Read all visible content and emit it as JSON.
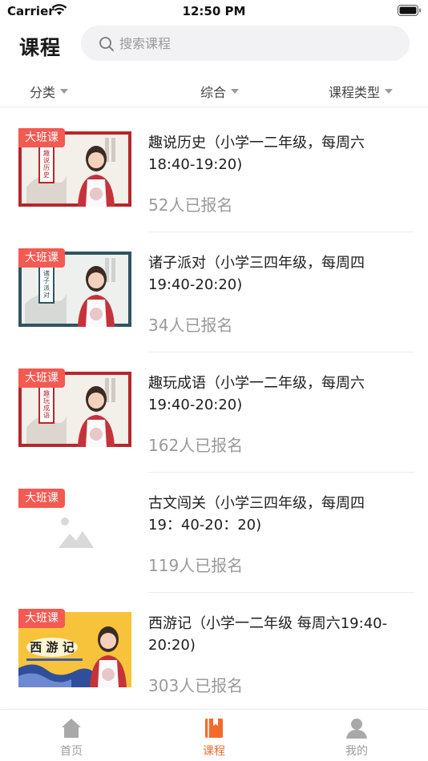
{
  "status_bar": {
    "carrier": "Carrier",
    "time": "12:50 PM"
  },
  "header": {
    "title": "课程",
    "search_placeholder": "搜索课程"
  },
  "filters": [
    {
      "label": "分类"
    },
    {
      "label": "综合"
    },
    {
      "label": "课程类型"
    }
  ],
  "courses": [
    {
      "badge": "大班课",
      "title": "趣说历史（小学一二年级，每周六18:40-19:20)",
      "enrolled": "52人已报名",
      "poster_text": "趣说历史",
      "poster_style": "red"
    },
    {
      "badge": "大班课",
      "title": "诸子派对（小学三四年级，每周四19:40-20:20)",
      "enrolled": "34人已报名",
      "poster_text": "诸子派对",
      "poster_style": "teal"
    },
    {
      "badge": "大班课",
      "title": "趣玩成语（小学一二年级，每周六19:40-20:20)",
      "enrolled": "162人已报名",
      "poster_text": "趣玩成语",
      "poster_style": "red"
    },
    {
      "badge": "大班课",
      "title": "古文闯关（小学三四年级，每周四19：40-20：20)",
      "enrolled": "119人已报名",
      "poster_text": "",
      "poster_style": "placeholder"
    },
    {
      "badge": "大班课",
      "title": "西游记（小学一二年级 每周六19:40-20:20)",
      "enrolled": "303人已报名",
      "poster_text": "西游记",
      "poster_style": "yellow"
    }
  ],
  "tabs": [
    {
      "label": "首页",
      "icon": "home-icon",
      "active": false
    },
    {
      "label": "课程",
      "icon": "book-icon",
      "active": true
    },
    {
      "label": "我的",
      "icon": "person-icon",
      "active": false
    }
  ],
  "colors": {
    "accent": "#f36b2c",
    "badge": "#f25a52",
    "muted_text": "#9a9a9a"
  }
}
